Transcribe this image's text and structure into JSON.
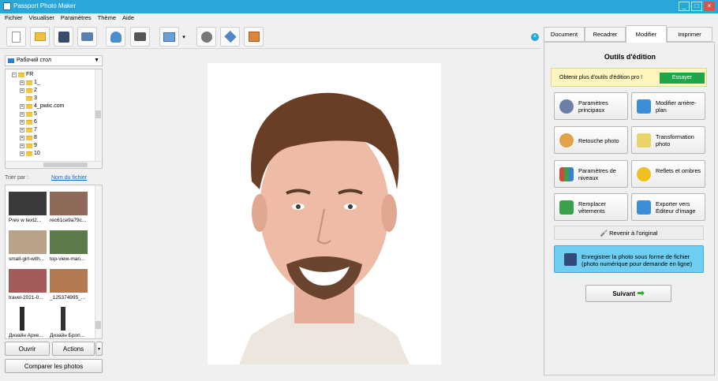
{
  "window": {
    "title": "Passport Photo Maker",
    "minimize": "_",
    "maximize": "□",
    "close": "×"
  },
  "menu": [
    "Fichier",
    "Visualiser",
    "Paramètres",
    "Thème",
    "Aide"
  ],
  "toolbar": {
    "buttons": [
      "new-doc-icon",
      "open-folder-icon",
      "save-disk-icon",
      "print-icon",
      "user-photo-icon",
      "camera-icon",
      "image-edit-icon",
      "film-reel-icon",
      "upload-box-icon",
      "gift-box-icon"
    ],
    "dropdown": "▾",
    "close": "×"
  },
  "browser": {
    "folder": "Рабочий стол",
    "tree": [
      {
        "label": "FR",
        "level": 0,
        "expand": "−"
      },
      {
        "label": "1_",
        "level": 1,
        "expand": "+"
      },
      {
        "label": "2",
        "level": 1,
        "expand": "+"
      },
      {
        "label": "3",
        "level": 1,
        "expand": ""
      },
      {
        "label": "4_pwiic.com",
        "level": 1,
        "expand": "+"
      },
      {
        "label": "5",
        "level": 1,
        "expand": "+"
      },
      {
        "label": "6",
        "level": 1,
        "expand": "+"
      },
      {
        "label": "7",
        "level": 1,
        "expand": "+"
      },
      {
        "label": "8",
        "level": 1,
        "expand": "+"
      },
      {
        "label": "9",
        "level": 1,
        "expand": "+"
      },
      {
        "label": "10",
        "level": 1,
        "expand": "+"
      }
    ],
    "sort_label": "Trier par :",
    "sort_value": "Nom du fichier",
    "thumbnails": [
      {
        "caption": "Prev w text2...",
        "color": "#3b3b3b"
      },
      {
        "caption": "rec61ce9a79c...",
        "color": "#8f6a5a"
      },
      {
        "caption": "small-girl-with...",
        "color": "#b9a28a"
      },
      {
        "caption": "top-view-man...",
        "color": "#5d7a4a"
      },
      {
        "caption": "travel-2021-0...",
        "color": "#a65b5b"
      },
      {
        "caption": "_125374995_...",
        "color": "#b37a52"
      },
      {
        "caption": "Дизайн Архе...",
        "color": "#2a2a2a"
      },
      {
        "caption": "Дизайн Броп...",
        "color": "#333333"
      }
    ],
    "open_label": "Ouvrir",
    "actions_label": "Actions",
    "compare_label": "Comparer les photos"
  },
  "tabs": [
    {
      "label": "Document",
      "active": false
    },
    {
      "label": "Recadrer",
      "active": false
    },
    {
      "label": "Modifier",
      "active": true
    },
    {
      "label": "Imprimer",
      "active": false
    }
  ],
  "panel": {
    "heading": "Outils d'édition",
    "promo_text": "Obtenir plus d'outils d'édition pro !",
    "promo_button": "Essayer",
    "tools": [
      {
        "label": "Paramètres principaux",
        "icon": "settings-gears-icon",
        "color": "#6b7fa8"
      },
      {
        "label": "Modifier arrière-plan",
        "icon": "paint-bucket-icon",
        "color": "#3a8fd6"
      },
      {
        "label": "Retouche photo",
        "icon": "palette-icon",
        "color": "#e0a34a"
      },
      {
        "label": "Transformation photo",
        "icon": "magic-wand-icon",
        "color": "#e8d46a"
      },
      {
        "label": "Paramètres de niveaux",
        "icon": "bar-levels-icon",
        "color": "#d04a3a"
      },
      {
        "label": "Reflets et ombres",
        "icon": "sun-shadow-icon",
        "color": "#f0c020"
      },
      {
        "label": "Remplacer vêtements",
        "icon": "clothes-icon",
        "color": "#3aa04a"
      },
      {
        "label": "Exporter vers Éditeur d'image",
        "icon": "export-editor-icon",
        "color": "#3a8fd6"
      }
    ],
    "revert_label": "Revenir à l'original",
    "save_label": "Enregistrer la photo sous forme de fichier (photo numérique pour demande en ligne)",
    "next_label": "Suivant"
  }
}
